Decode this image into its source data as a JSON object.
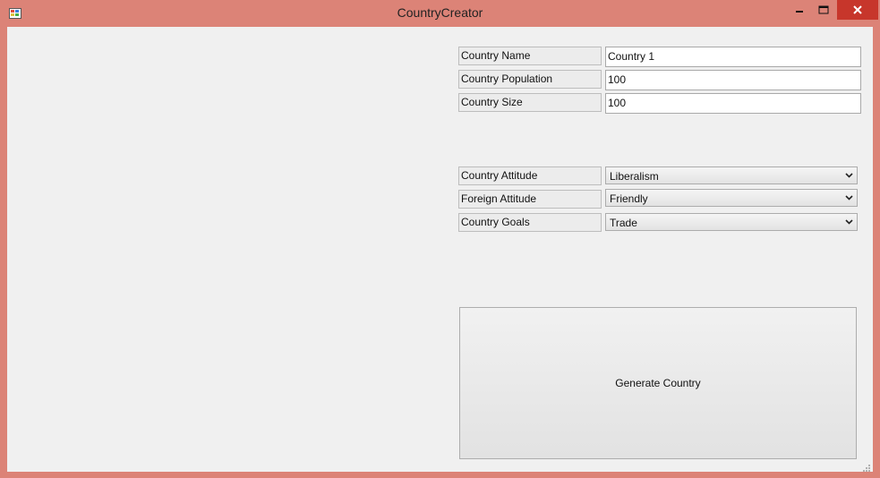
{
  "window": {
    "title": "CountryCreator",
    "controls": {
      "minimize": "‒",
      "maximize": "□",
      "close": "✕"
    }
  },
  "form": {
    "fields": [
      {
        "label": "Country Name",
        "value": "Country 1"
      },
      {
        "label": "Country Population",
        "value": "100"
      },
      {
        "label": "Country Size",
        "value": "100"
      }
    ],
    "dropdowns": [
      {
        "label": "Country Attitude",
        "value": "Liberalism"
      },
      {
        "label": "Foreign Attitude",
        "value": "Friendly"
      },
      {
        "label": "Country Goals",
        "value": "Trade"
      }
    ],
    "generate_label": "Generate Country"
  },
  "icons": {
    "app": "app-icon",
    "dropdown": "chevron-down-icon",
    "resize": "size-grip-icon"
  },
  "colors": {
    "frame": "#dc8377",
    "close_button": "#c7362b",
    "client": "#f0f0f0"
  }
}
